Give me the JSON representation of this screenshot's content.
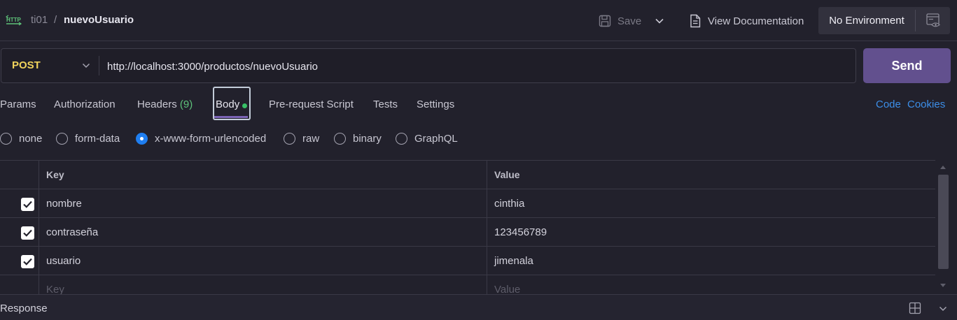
{
  "header": {
    "protocol_badge": "HTTP",
    "breadcrumb_parent": "ti01",
    "breadcrumb_separator": "/",
    "breadcrumb_current": "nuevoUsuario",
    "save_label": "Save",
    "view_docs_label": "View Documentation",
    "environment": "No Environment"
  },
  "request": {
    "method": "POST",
    "url": "http://localhost:3000/productos/nuevoUsuario",
    "send_label": "Send"
  },
  "tabs": {
    "params": "Params",
    "authorization": "Authorization",
    "headers": "Headers",
    "headers_count": "(9)",
    "body": "Body",
    "prerequest": "Pre-request Script",
    "tests": "Tests",
    "settings": "Settings",
    "code_link": "Code",
    "cookies_link": "Cookies"
  },
  "body_types": {
    "none": "none",
    "form_data": "form-data",
    "urlencoded": "x-www-form-urlencoded",
    "raw": "raw",
    "binary": "binary",
    "graphql": "GraphQL",
    "selected": "x-www-form-urlencoded"
  },
  "table": {
    "key_header": "Key",
    "value_header": "Value",
    "rows": [
      {
        "key": "nombre",
        "value": "cinthia",
        "enabled": true
      },
      {
        "key": "contraseña",
        "value": "123456789",
        "enabled": true
      },
      {
        "key": "usuario",
        "value": "jimenala",
        "enabled": true
      }
    ],
    "key_placeholder": "Key",
    "value_placeholder": "Value"
  },
  "response": {
    "label": "Response"
  },
  "colors": {
    "background": "#22212c",
    "method": "#f0d35c",
    "send_button": "#62508e",
    "link": "#3c8ee8",
    "radio_selected": "#1f7ef0",
    "success_dot": "#37c066"
  },
  "icons": {
    "protocol": "http-icon",
    "save": "save-icon",
    "save_menu": "chevron-down-icon",
    "docs": "document-icon",
    "environment_quick_look": "eye-icon",
    "layout": "split-layout-icon",
    "collapse": "chevron-down-icon"
  }
}
